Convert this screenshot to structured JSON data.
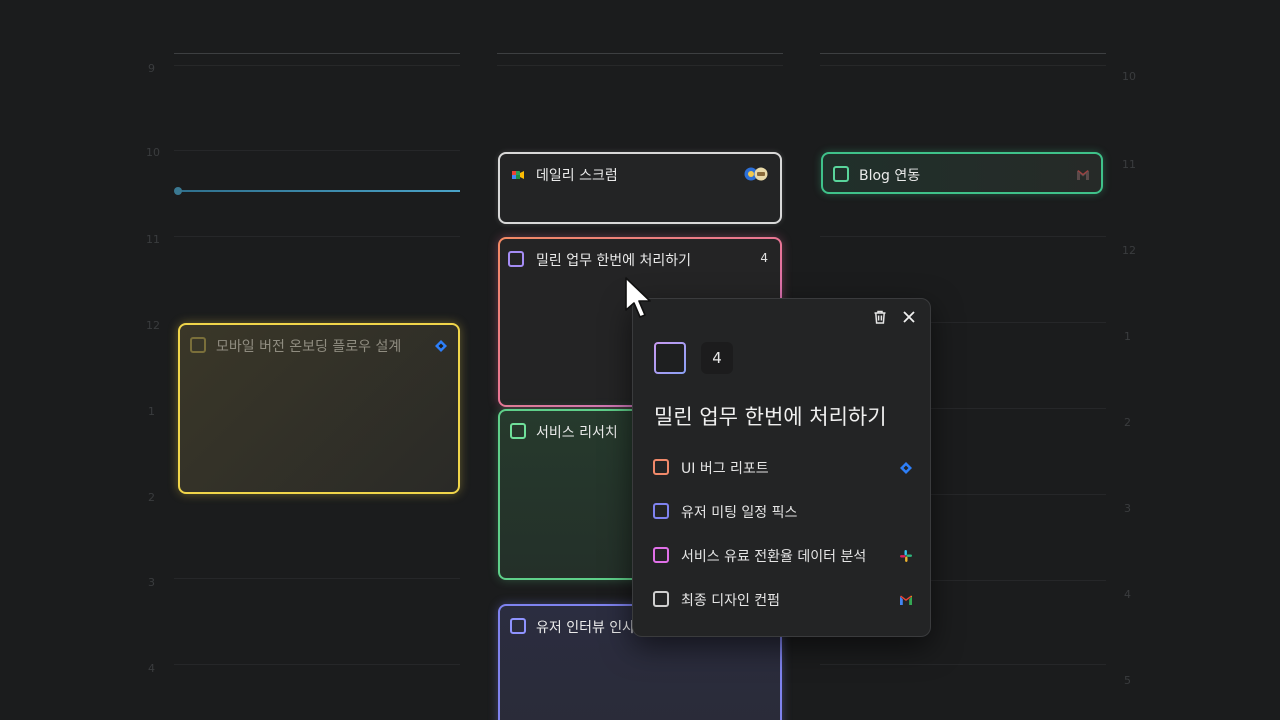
{
  "hours_left": [
    "9",
    "10",
    "11",
    "12",
    "1",
    "2",
    "3",
    "4"
  ],
  "hours_right": [
    "10",
    "11",
    "12",
    "1",
    "2",
    "3",
    "4",
    "5"
  ],
  "events": {
    "scrum": {
      "title": "데일리 스크럼",
      "icon": "google-meet-icon"
    },
    "blog": {
      "title": "Blog 연동",
      "icon": "gmail-icon"
    },
    "backlog": {
      "title": "밀린 업무 한번에 처리하기",
      "count": "4"
    },
    "mobile": {
      "title": "모바일 버전 온보딩 플로우 설계",
      "icon": "jira-icon"
    },
    "research": {
      "title": "서비스 리서치"
    },
    "interview": {
      "title": "유저 인터뷰 인사"
    }
  },
  "popup": {
    "count": "4",
    "title": "밀린 업무 한번에 처리하기",
    "delete_icon": "trash-icon",
    "close_icon": "close-icon",
    "tasks": [
      {
        "label": "UI 버그 리포트",
        "color": "#f0896a",
        "icon": "jira-icon"
      },
      {
        "label": "유저 미팅 일정 픽스",
        "color": "#7f83f0",
        "icon": ""
      },
      {
        "label": "서비스 유료 전환율 데이터 분석",
        "color": "#e070e8",
        "icon": "slack-icon"
      },
      {
        "label": "최종 디자인 컨펌",
        "color": "#cfcfcf",
        "icon": "gmail-icon"
      }
    ]
  },
  "colors": {
    "background": "#1b1c1d",
    "now_line": "#4aa3c8"
  }
}
